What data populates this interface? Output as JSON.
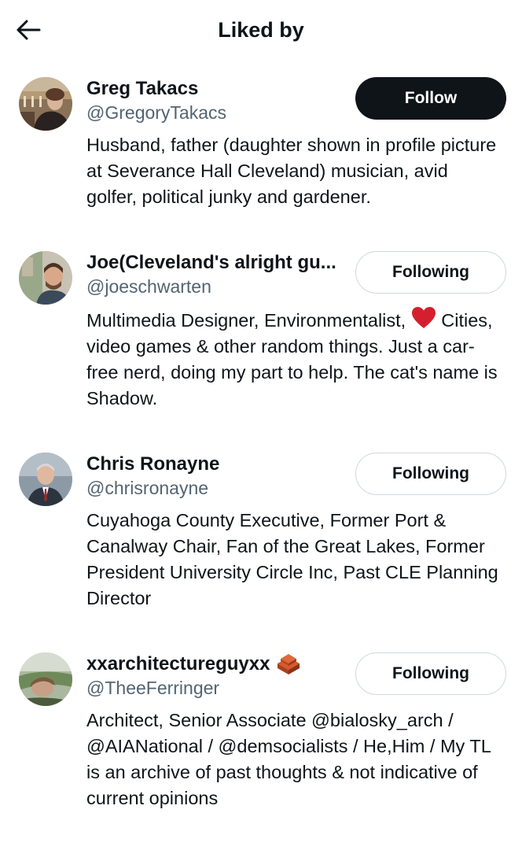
{
  "header": {
    "title": "Liked by",
    "back_icon": "arrow-left-icon"
  },
  "users": [
    {
      "name": "Greg Takacs",
      "handle": "@GregoryTakacs",
      "button": "Follow",
      "bio": "Husband, father (daughter shown in profile picture at Severance Hall Cleveland) musician, avid golfer, political junky and gardener."
    },
    {
      "name": "Joe(Cleveland's alright gu...",
      "handle": "@joeschwarten",
      "button": "Following",
      "bio_before_heart": "Multimedia Designer, Environmentalist, ",
      "bio_after_heart": " Cities, video games & other random things. Just a car-free nerd, doing my part to help. The cat's name is Shadow."
    },
    {
      "name": "Chris Ronayne",
      "handle": "@chrisronayne",
      "button": "Following",
      "bio": "Cuyahoga County Executive, Former Port & Canalway Chair, Fan of the Great Lakes, Former President University Circle Inc, Past CLE Planning Director"
    },
    {
      "name": "xxarchitectureguyxx",
      "handle": "@TheeFerringer",
      "button": "Following",
      "bio": "Architect, Senior Associate @bialosky_arch / @AIANational / @demsocialists / He,Him / My TL is an archive of past thoughts & not indicative of current opinions"
    }
  ],
  "colors": {
    "text": "#0f1419",
    "secondary": "#536471",
    "follow_bg": "#0f1419",
    "following_border": "#cfd9de",
    "heart": "#e0245e"
  }
}
